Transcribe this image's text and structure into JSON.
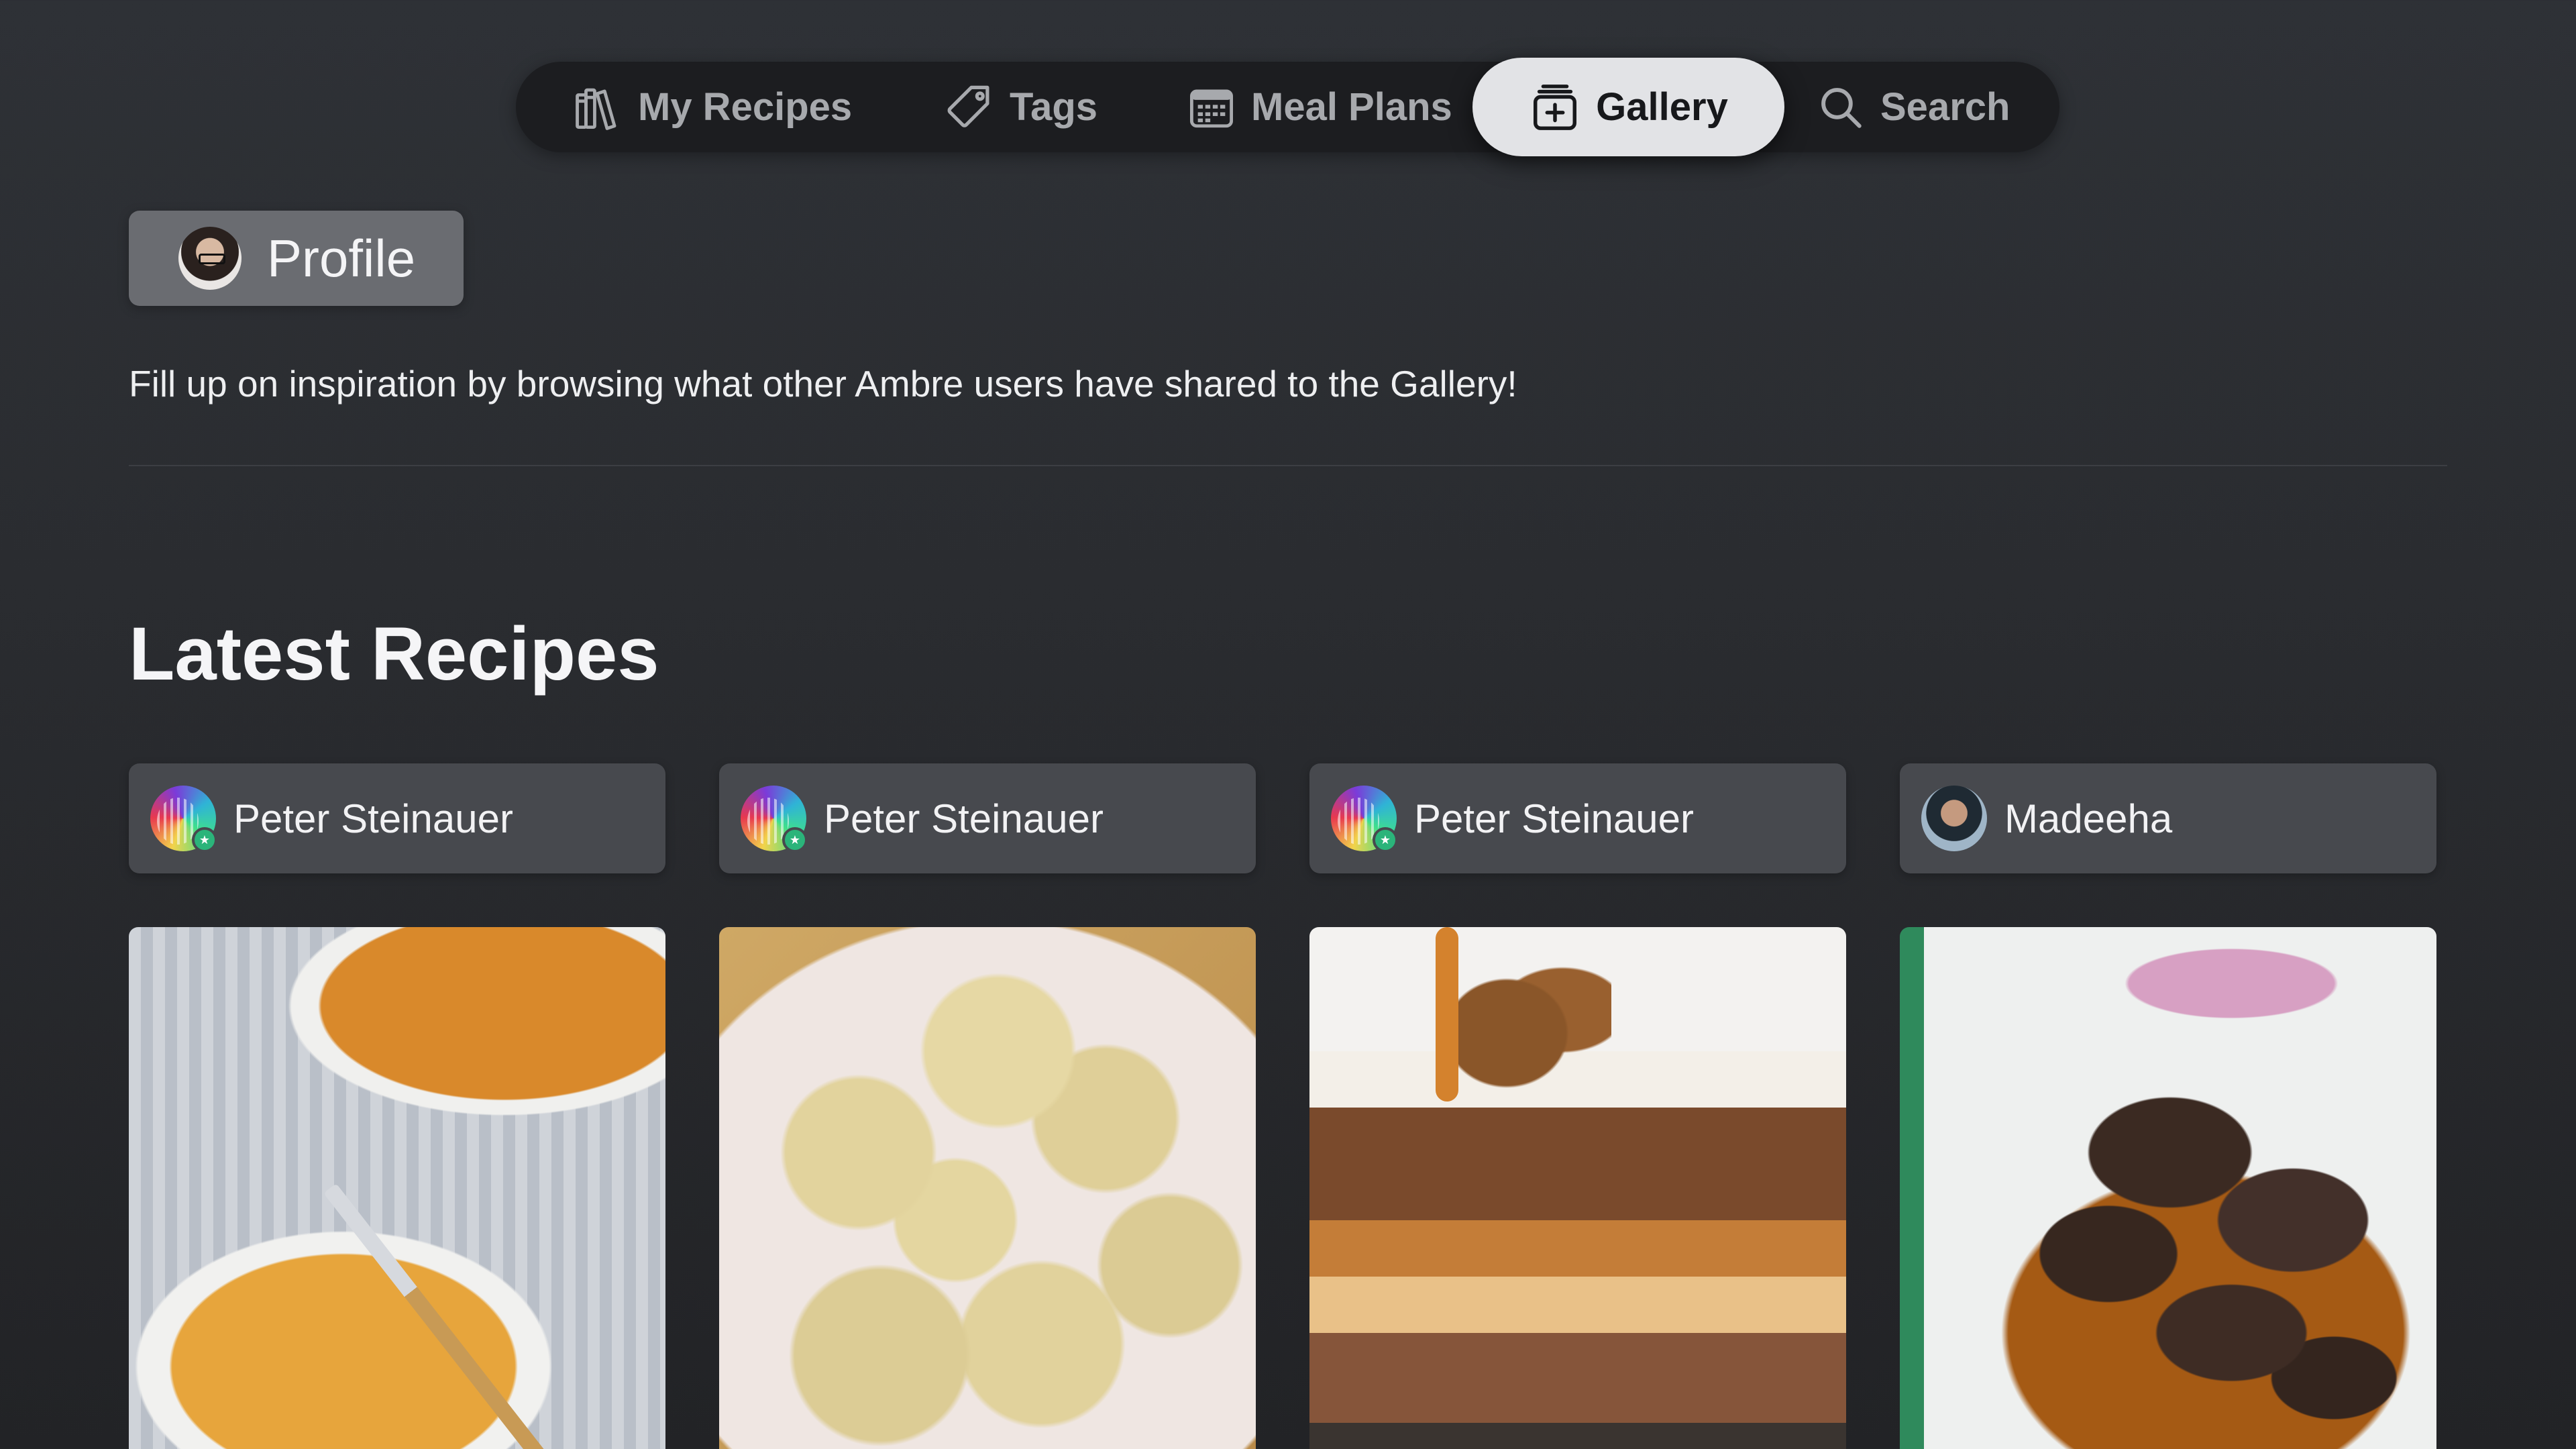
{
  "tabs": [
    {
      "id": "recipes",
      "label": "My Recipes",
      "icon": "books-icon"
    },
    {
      "id": "tags",
      "label": "Tags",
      "icon": "tag-icon"
    },
    {
      "id": "meal_plans",
      "label": "Meal Plans",
      "icon": "calendar-icon"
    },
    {
      "id": "gallery",
      "label": "Gallery",
      "icon": "gallery-icon",
      "active": true
    },
    {
      "id": "search",
      "label": "Search",
      "icon": "search-icon"
    }
  ],
  "profile": {
    "label": "Profile"
  },
  "intro": "Fill up on inspiration by browsing what other Ambre users have shared to the Gallery!",
  "section_title": "Latest Recipes",
  "recipes": [
    {
      "author": "Peter Steinauer",
      "photo": "Macaroni and cheese"
    },
    {
      "author": "Peter Steinauer",
      "photo": "Rice balls"
    },
    {
      "author": "Peter Steinauer",
      "photo": "Biscoff trifle"
    },
    {
      "author": "Madeeha",
      "photo": "Grilled meat with onions"
    }
  ],
  "colors": {
    "background": "#2a2c30",
    "tabbar": "#1c1d20",
    "active_tab": "#e2e3e6",
    "author_card": "#47494e",
    "profile_button": "#6a6c71"
  }
}
